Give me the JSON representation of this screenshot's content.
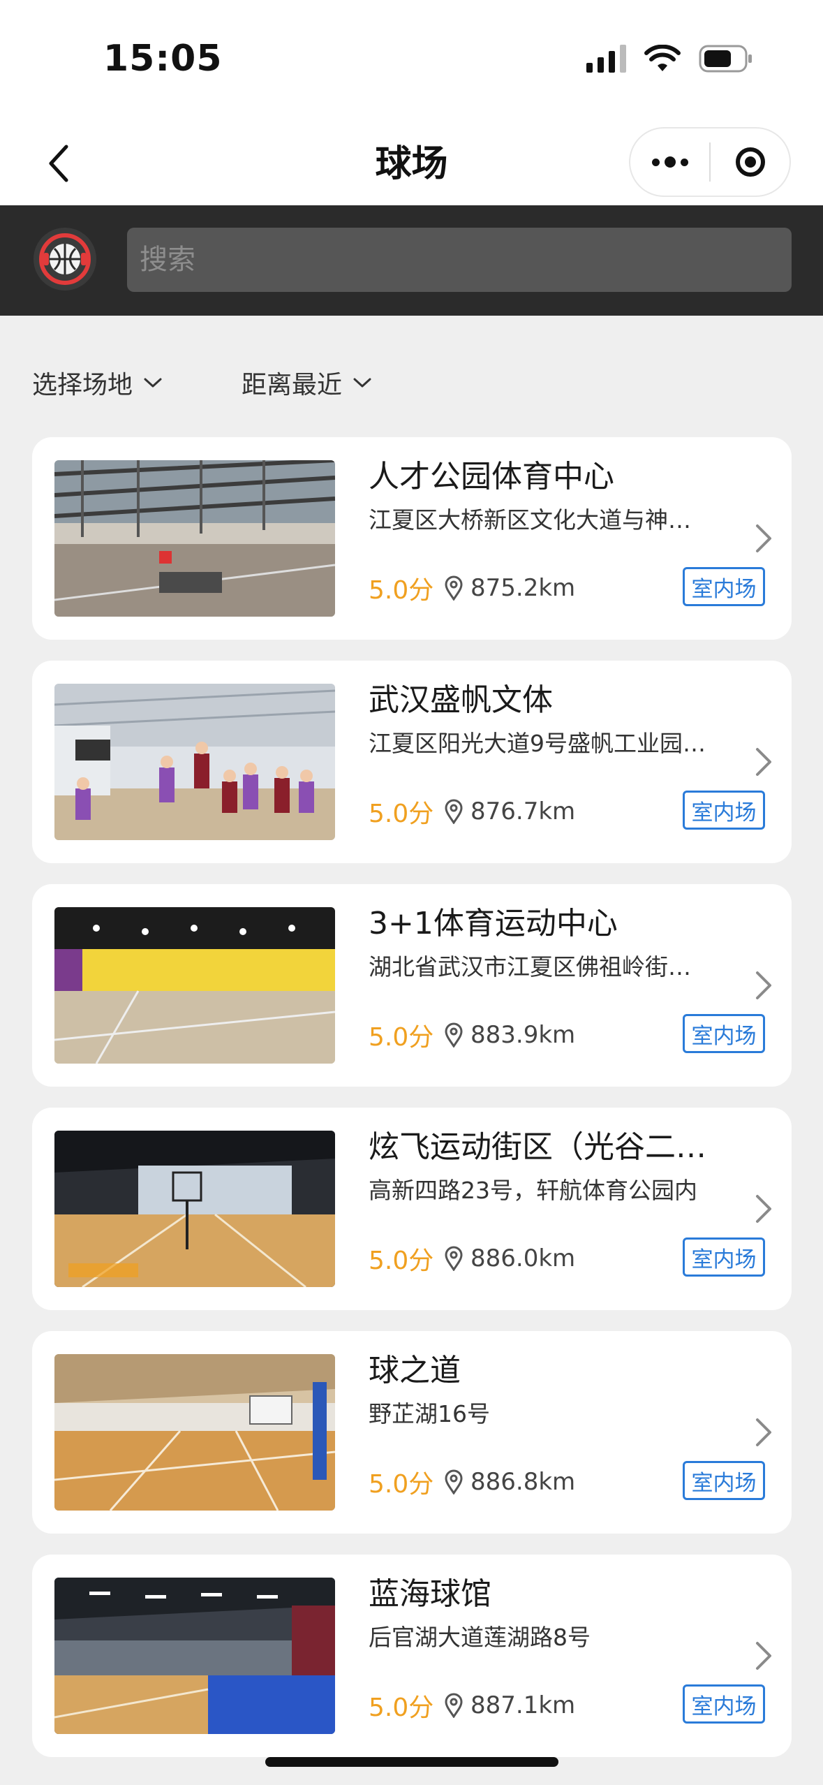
{
  "status_bar": {
    "time": "15:05"
  },
  "nav": {
    "title": "球场"
  },
  "search": {
    "placeholder": "搜索"
  },
  "filters": [
    {
      "label": "选择场地"
    },
    {
      "label": "距离最近"
    }
  ],
  "courts": [
    {
      "name": "人才公园体育中心",
      "address": "江夏区大桥新区文化大道与神…",
      "score": "5.0分",
      "distance": "875.2km",
      "tag": "室内场",
      "image": "indoor-court-construction"
    },
    {
      "name": "武汉盛帆文体",
      "address": "江夏区阳光大道9号盛帆工业园…",
      "score": "5.0分",
      "distance": "876.7km",
      "tag": "室内场",
      "image": "players-game-photo"
    },
    {
      "name": "3+1体育运动中心",
      "address": "湖北省武汉市江夏区佛祖岭街…",
      "score": "5.0分",
      "distance": "883.9km",
      "tag": "室内场",
      "image": "yellow-wall-court"
    },
    {
      "name": "炫飞运动街区（光谷二…",
      "address": "高新四路23号，轩航体育公园内",
      "score": "5.0分",
      "distance": "886.0km",
      "tag": "室内场",
      "image": "dark-hall-court"
    },
    {
      "name": "球之道",
      "address": "野芷湖16号",
      "score": "5.0分",
      "distance": "886.8km",
      "tag": "室内场",
      "image": "wood-court-tent"
    },
    {
      "name": "蓝海球馆",
      "address": "后官湖大道莲湖路8号",
      "score": "5.0分",
      "distance": "887.1km",
      "tag": "室内场",
      "image": "blue-floor-court"
    }
  ],
  "colors": {
    "accent": "#2a7bd9",
    "score": "#f0a020",
    "header": "#2b2b2b"
  }
}
